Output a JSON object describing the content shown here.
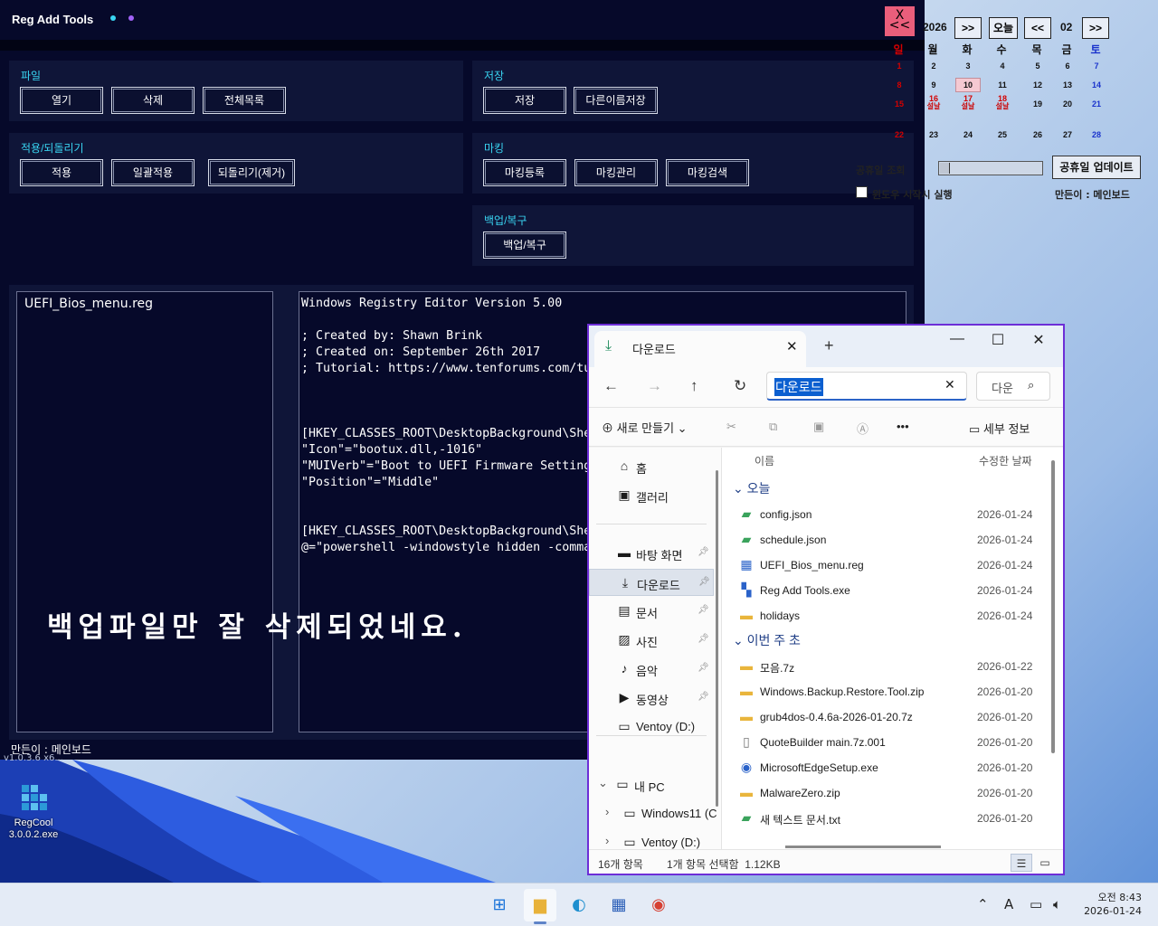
{
  "reg_tool": {
    "title": "Reg Add Tools",
    "close_label": "X\n<<",
    "file_panel": {
      "label": "파일",
      "buttons": [
        "열기",
        "삭제",
        "전체목록"
      ]
    },
    "save_panel": {
      "label": "저장",
      "buttons": [
        "저장",
        "다른이름저장"
      ]
    },
    "apply_panel": {
      "label": "적용/되돌리기",
      "buttons": [
        "적용",
        "일괄적용",
        "되돌리기(제거)"
      ]
    },
    "marking_panel": {
      "label": "마킹",
      "buttons": [
        "마킹등록",
        "마킹관리",
        "마킹검색"
      ]
    },
    "backup_panel": {
      "label": "백업/복구",
      "buttons": [
        "백업/복구"
      ]
    },
    "file_list": [
      "UEFI_Bios_menu.reg"
    ],
    "editor_lines": [
      "Windows Registry Editor Version 5.00",
      "",
      "; Created by: Shawn Brink",
      "; Created on: September 26th 2017",
      "; Tutorial: https://www.tenforums.com/tu",
      "",
      "",
      "",
      "[HKEY_CLASSES_ROOT\\DesktopBackground\\She",
      "\"Icon\"=\"bootux.dll,-1016\"",
      "\"MUIVerb\"=\"Boot to UEFI Firmware Setting",
      "\"Position\"=\"Middle\"",
      "",
      "",
      "[HKEY_CLASSES_ROOT\\DesktopBackground\\She",
      "@=\"powershell -windowstyle hidden -comma"
    ],
    "overlay_message": "백업파일만 잘 삭제되었네요.",
    "maker": "만든이 : 메인보드",
    "faint_text": "v1.0.3.6 x6..."
  },
  "calendar": {
    "year": "2026",
    "month": "02",
    "today_button": "오늘",
    "prev": "<<",
    "next": ">>",
    "weekdays": [
      "일",
      "월",
      "화",
      "수",
      "목",
      "금",
      "토"
    ],
    "weeks": [
      [
        {
          "d": "1"
        },
        {
          "d": "2"
        },
        {
          "d": "3"
        },
        {
          "d": "4"
        },
        {
          "d": "5"
        },
        {
          "d": "6"
        },
        {
          "d": "7"
        }
      ],
      [
        {
          "d": "8"
        },
        {
          "d": "9"
        },
        {
          "d": "10",
          "today": true
        },
        {
          "d": "11"
        },
        {
          "d": "12"
        },
        {
          "d": "13"
        },
        {
          "d": "14"
        }
      ],
      [
        {
          "d": "15"
        },
        {
          "d": "16",
          "sub": "설날"
        },
        {
          "d": "17",
          "sub": "설날"
        },
        {
          "d": "18",
          "sub": "설날"
        },
        {
          "d": "19"
        },
        {
          "d": "20"
        },
        {
          "d": "21"
        }
      ],
      [
        {
          "d": "22"
        },
        {
          "d": "23"
        },
        {
          "d": "24"
        },
        {
          "d": "25"
        },
        {
          "d": "26"
        },
        {
          "d": "27"
        },
        {
          "d": "28"
        }
      ]
    ],
    "status_label": "공휴일 조회",
    "progress": 0.1,
    "update_button": "공휴일 업데이트",
    "startup_label": "윈도우 시작시 실행",
    "maker": "만든이 : 메인보드"
  },
  "explorer": {
    "tab_title": "다운로드",
    "address": "다운로드",
    "search_placeholder": "다운",
    "new_button": "새로 만들기",
    "details_button": "세부 정보",
    "column_name": "이름",
    "column_date": "수정한 날짜",
    "sidebar": [
      {
        "label": "홈",
        "icon": "home-icon",
        "glyph": "⌂"
      },
      {
        "label": "갤러리",
        "icon": "gallery-icon",
        "glyph": "▣"
      },
      {
        "label": "바탕 화면",
        "icon": "desktop-icon",
        "glyph": "▬",
        "pin": true
      },
      {
        "label": "다운로드",
        "icon": "download-icon",
        "glyph": "⤓",
        "pin": true,
        "selected": true
      },
      {
        "label": "문서",
        "icon": "document-icon",
        "glyph": "▤",
        "pin": true
      },
      {
        "label": "사진",
        "icon": "pictures-icon",
        "glyph": "▨",
        "pin": true
      },
      {
        "label": "음악",
        "icon": "music-icon",
        "glyph": "♪",
        "pin": true
      },
      {
        "label": "동영상",
        "icon": "video-icon",
        "glyph": "▶",
        "pin": true
      },
      {
        "label": "Ventoy (D:)",
        "icon": "drive-icon",
        "glyph": "▭"
      },
      {
        "label": "내 PC",
        "icon": "pc-icon",
        "glyph": "▭",
        "expand": "v"
      },
      {
        "label": "Windows11 (C",
        "icon": "drive-icon",
        "glyph": "▭",
        "expand": ">"
      },
      {
        "label": "Ventoy (D:)",
        "icon": "drive-icon",
        "glyph": "▭",
        "expand": ">"
      }
    ],
    "groups": [
      {
        "label": "오늘",
        "files": [
          {
            "name": "config.json",
            "date": "2026-01-24",
            "icon": "json-file-icon",
            "glyph": "▰",
            "color": "#3aa35c"
          },
          {
            "name": "schedule.json",
            "date": "2026-01-24",
            "icon": "json-file-icon",
            "glyph": "▰",
            "color": "#3aa35c"
          },
          {
            "name": "UEFI_Bios_menu.reg",
            "date": "2026-01-24",
            "icon": "reg-file-icon",
            "glyph": "▦",
            "color": "#2a62c9"
          },
          {
            "name": "Reg Add Tools.exe",
            "date": "2026-01-24",
            "icon": "exe-file-icon",
            "glyph": "▚",
            "color": "#2a62c9"
          },
          {
            "name": "holidays",
            "date": "2026-01-24",
            "icon": "folder-icon",
            "glyph": "▬",
            "color": "#e9b53c"
          }
        ]
      },
      {
        "label": "이번 주 초",
        "files": [
          {
            "name": "모음.7z",
            "date": "2026-01-22",
            "icon": "archive-icon",
            "glyph": "▬",
            "color": "#e9b53c"
          },
          {
            "name": "Windows.Backup.Restore.Tool.zip",
            "date": "2026-01-20",
            "icon": "archive-icon",
            "glyph": "▬",
            "color": "#e9b53c"
          },
          {
            "name": "grub4dos-0.4.6a-2026-01-20.7z",
            "date": "2026-01-20",
            "icon": "archive-icon",
            "glyph": "▬",
            "color": "#e9b53c"
          },
          {
            "name": "QuoteBuilder main.7z.001",
            "date": "2026-01-20",
            "icon": "file-icon",
            "glyph": "▯",
            "color": "#777"
          },
          {
            "name": "MicrosoftEdgeSetup.exe",
            "date": "2026-01-20",
            "icon": "installer-icon",
            "glyph": "◉",
            "color": "#2a62c9"
          },
          {
            "name": "MalwareZero.zip",
            "date": "2026-01-20",
            "icon": "archive-icon",
            "glyph": "▬",
            "color": "#e9b53c"
          },
          {
            "name": "새 텍스트 문서.txt",
            "date": "2026-01-20",
            "icon": "text-file-icon",
            "glyph": "▰",
            "color": "#3aa35c"
          }
        ]
      }
    ],
    "status_count": "16개 항목",
    "status_selected": "1개 항목 선택함  1.12KB"
  },
  "desktop": {
    "icon_label": "RegCool\n3.0.0.2.exe"
  },
  "taskbar": {
    "apps": [
      {
        "name": "start-button",
        "glyph": "⊞",
        "color": "#1a73d9"
      },
      {
        "name": "file-explorer-taskbar-icon",
        "glyph": "▆",
        "color": "#e8b23a",
        "active": true
      },
      {
        "name": "edge-taskbar-icon",
        "glyph": "◐",
        "color": "#1f8fcf"
      },
      {
        "name": "store-taskbar-icon",
        "glyph": "▦",
        "color": "#2b5fb8"
      },
      {
        "name": "chrome-taskbar-icon",
        "glyph": "◉",
        "color": "#d64033"
      }
    ],
    "tray_ime": "A",
    "clock_time": "오전 8:43",
    "clock_date": "2026-01-24"
  }
}
